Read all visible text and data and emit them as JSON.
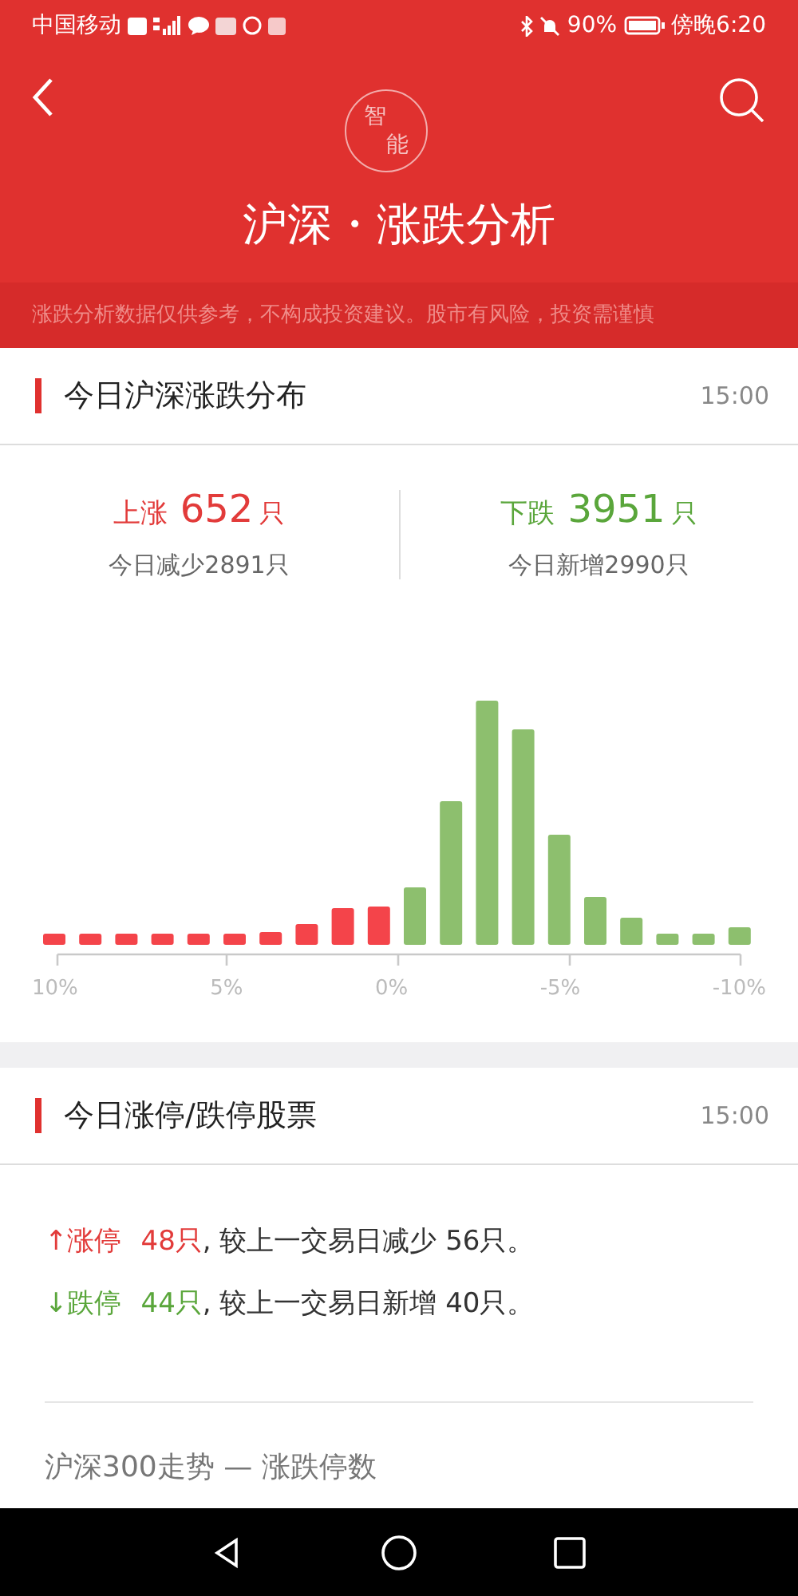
{
  "status_bar": {
    "carrier": "中国移动",
    "battery": "90%",
    "time": "傍晚6:20"
  },
  "header": {
    "logo_top": "智",
    "logo_bottom": "能",
    "title": "沪深・涨跌分析"
  },
  "disclaimer": "涨跌分析数据仅供参考，不构成投资建议。股市有风险，投资需谨慎",
  "distribution": {
    "title": "今日沪深涨跌分布",
    "time": "15:00",
    "stats": [
      {
        "kind": "up",
        "label": "上涨",
        "count": "652",
        "unit": "只",
        "change": "今日减少2891只"
      },
      {
        "kind": "down",
        "label": "下跌",
        "count": "3951",
        "unit": "只",
        "change": "今日新增2990只"
      }
    ],
    "axis_labels": [
      "10%",
      "5%",
      "0%",
      "-5%",
      "-10%"
    ]
  },
  "limits": {
    "title": "今日涨停/跌停股票",
    "time": "15:00",
    "lines": [
      {
        "kind": "up",
        "label": "↑涨停",
        "count": "48只",
        "text": ", 较上一交易日减少 56只。"
      },
      {
        "kind": "down",
        "label": "↓跌停",
        "count": "44只",
        "text": ", 较上一交易日新增 40只。"
      }
    ],
    "subtitle": "沪深300走势 — 涨跌停数"
  }
}
